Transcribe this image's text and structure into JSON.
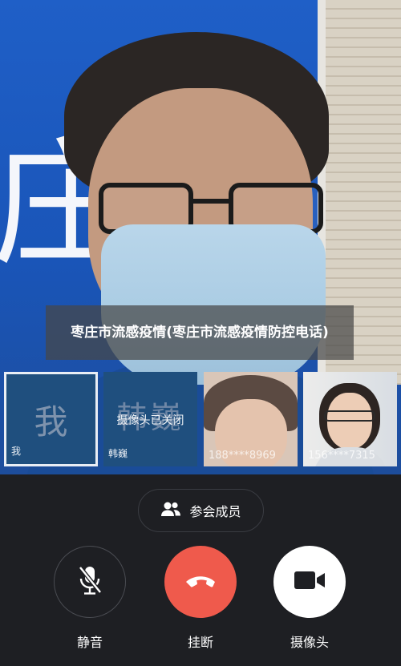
{
  "main_video": {
    "background_sign_text": "庄",
    "caption": "枣庄市流感疫情(枣庄市流感疫情防控电话)"
  },
  "participants": [
    {
      "avatar_text": "我",
      "name": "我",
      "selected": true
    },
    {
      "avatar_text": "韩巍",
      "name": "韩巍",
      "status": "摄像头已关闭"
    },
    {
      "phone": "188****8969"
    },
    {
      "phone": "156****7315"
    }
  ],
  "controls": {
    "members_label": "参会成员",
    "mute_label": "静音",
    "hangup_label": "挂断",
    "camera_label": "摄像头"
  },
  "colors": {
    "background": "#1e1f23",
    "hangup": "#ef5a4c",
    "camera_button": "#ffffff",
    "tile_blue": "#1f4f7e"
  },
  "icons": {
    "members": "people-icon",
    "mute": "mic-off-icon",
    "hangup": "phone-hangup-icon",
    "camera": "video-camera-icon"
  }
}
